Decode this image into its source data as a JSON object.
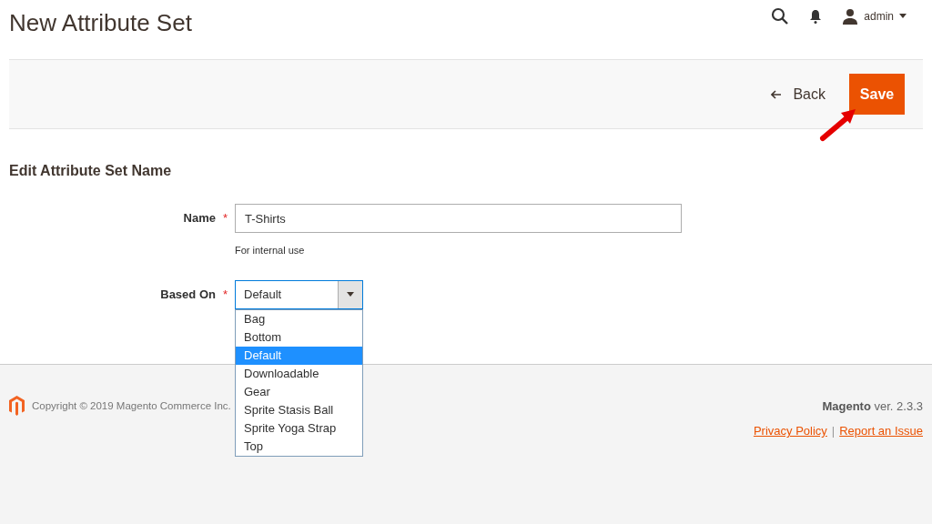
{
  "page_title": "New Attribute Set",
  "header": {
    "user": "admin"
  },
  "actions": {
    "back": "Back",
    "save": "Save"
  },
  "section_title": "Edit Attribute Set Name",
  "name_field": {
    "label": "Name",
    "required_mark": "*",
    "value": "T-Shirts",
    "hint": "For internal use"
  },
  "based_on": {
    "label": "Based On",
    "required_mark": "*",
    "value": "Default",
    "expanded": true,
    "options": [
      {
        "label": "Bag",
        "selected": false
      },
      {
        "label": "Bottom",
        "selected": false
      },
      {
        "label": "Default",
        "selected": true
      },
      {
        "label": "Downloadable",
        "selected": false
      },
      {
        "label": "Gear",
        "selected": false
      },
      {
        "label": "Sprite Stasis Ball",
        "selected": false
      },
      {
        "label": "Sprite Yoga Strap",
        "selected": false
      },
      {
        "label": "Top",
        "selected": false
      }
    ]
  },
  "footer": {
    "copyright": "Copyright © 2019 Magento Commerce Inc.",
    "brand": "Magento",
    "version": "ver. 2.3.3",
    "links": [
      "Privacy Policy",
      "Report an Issue"
    ],
    "separator": "|"
  }
}
